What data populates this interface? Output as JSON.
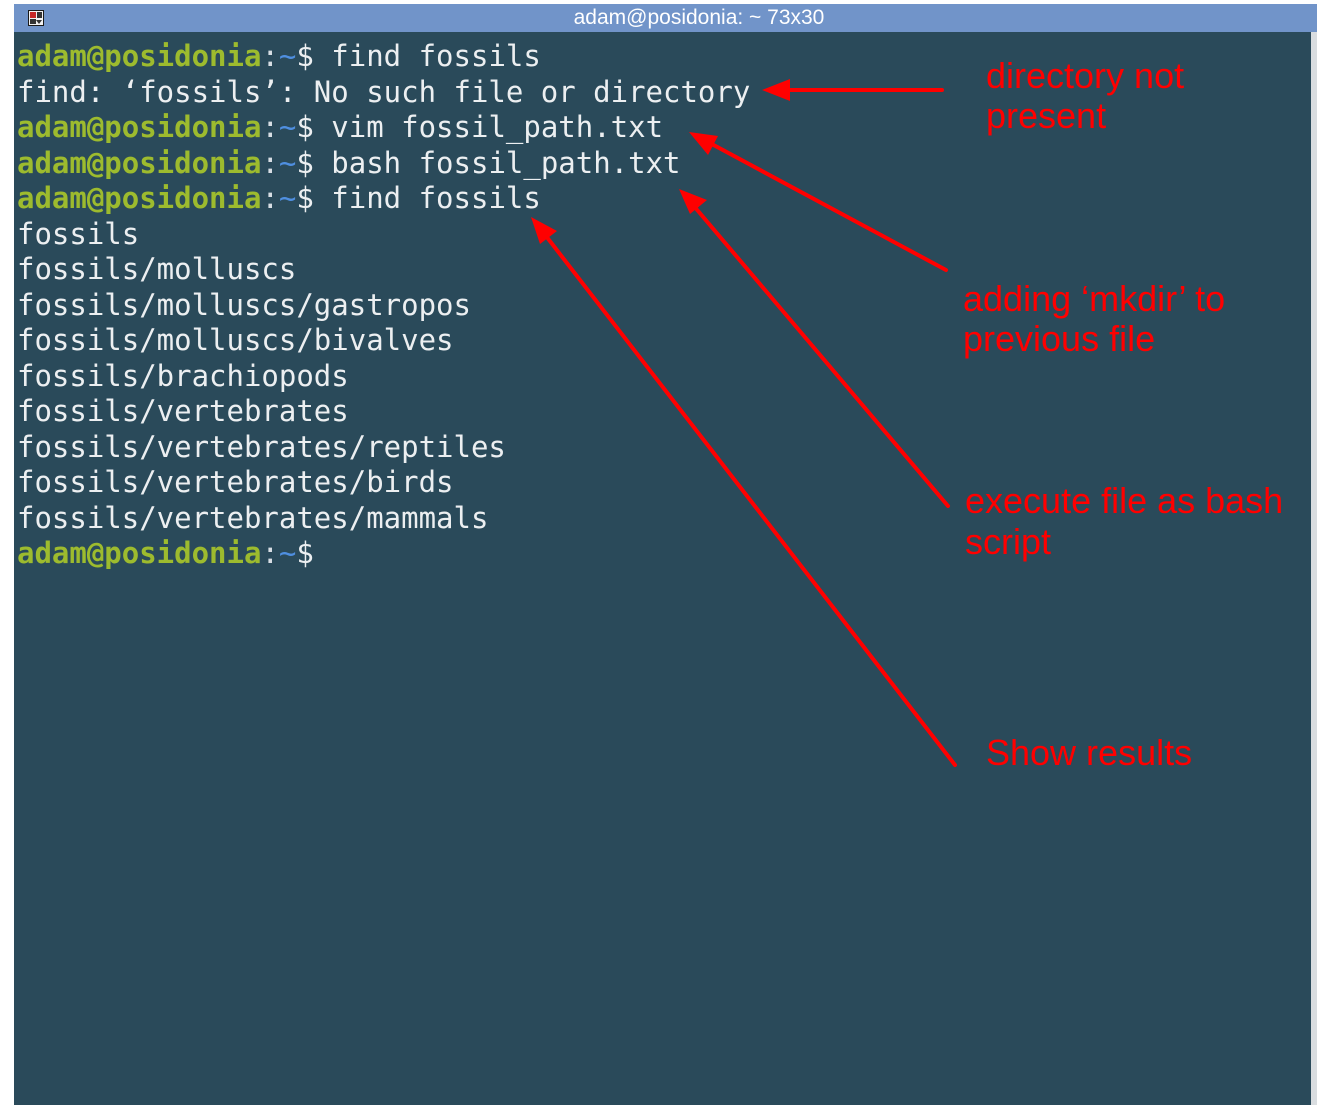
{
  "window": {
    "title": "adam@posidonia: ~ 73x30"
  },
  "colors": {
    "terminal_bg": "#2a4a5a",
    "titlebar_bg": "#7194c9",
    "prompt_user": "#9dbb2e",
    "prompt_path": "#4f8fe0",
    "annotation": "#ff0000"
  },
  "prompt": {
    "user_host": "adam@posidonia",
    "sep": ":",
    "path": "~",
    "dollar": "$"
  },
  "terminal": {
    "lines": [
      {
        "prompt": true,
        "text": " find fossils"
      },
      {
        "prompt": false,
        "text": "find: ‘fossils’: No such file or directory"
      },
      {
        "prompt": true,
        "text": " vim fossil_path.txt"
      },
      {
        "prompt": true,
        "text": " bash fossil_path.txt"
      },
      {
        "prompt": true,
        "text": " find fossils"
      },
      {
        "prompt": false,
        "text": "fossils"
      },
      {
        "prompt": false,
        "text": "fossils/molluscs"
      },
      {
        "prompt": false,
        "text": "fossils/molluscs/gastropos"
      },
      {
        "prompt": false,
        "text": "fossils/molluscs/bivalves"
      },
      {
        "prompt": false,
        "text": "fossils/brachiopods"
      },
      {
        "prompt": false,
        "text": "fossils/vertebrates"
      },
      {
        "prompt": false,
        "text": "fossils/vertebrates/reptiles"
      },
      {
        "prompt": false,
        "text": "fossils/vertebrates/birds"
      },
      {
        "prompt": false,
        "text": "fossils/vertebrates/mammals"
      },
      {
        "prompt": true,
        "text": ""
      }
    ]
  },
  "annotations": {
    "directory_not_present": [
      "directory not",
      "present"
    ],
    "adding_mkdir": [
      "adding ‘mkdir’ to",
      "previous file"
    ],
    "execute_bash": [
      "execute file as bash",
      "script"
    ],
    "show_results": [
      "Show results"
    ]
  }
}
